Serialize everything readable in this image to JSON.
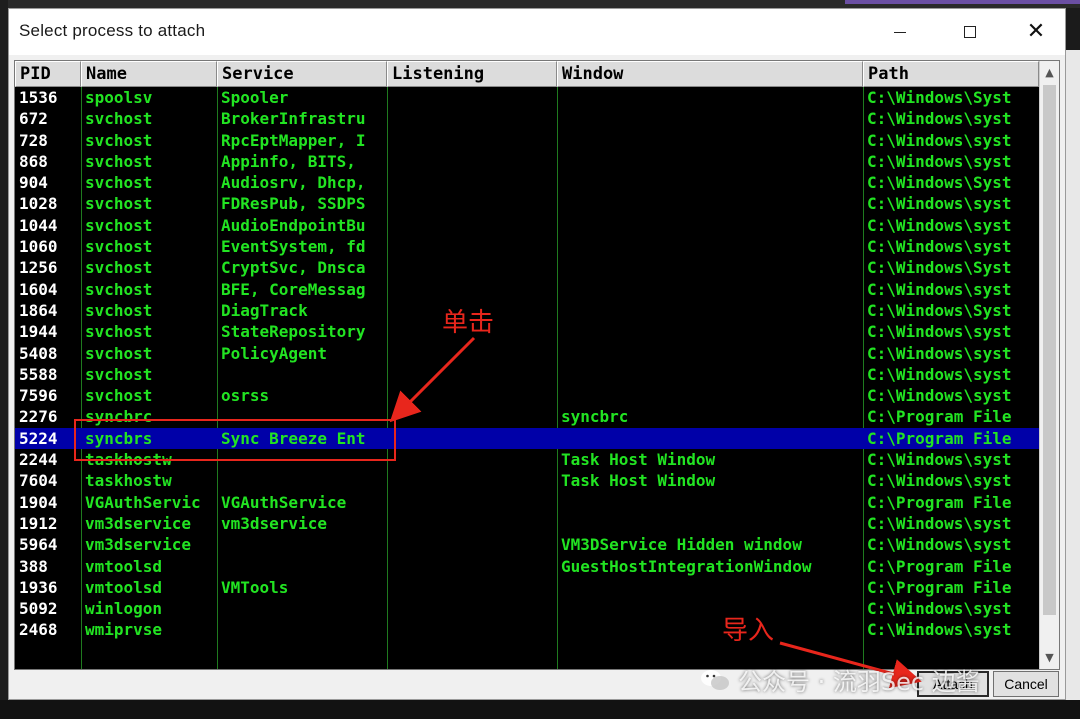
{
  "window": {
    "title": "Select process to attach",
    "close_glyph": "✕"
  },
  "table": {
    "headers": [
      "PID",
      "Name",
      "Service",
      "Listening",
      "Window",
      "Path"
    ],
    "rows": [
      {
        "pid": "1536",
        "name": "spoolsv",
        "service": "Spooler",
        "listening": "",
        "window": "",
        "path": "C:\\Windows\\Syst"
      },
      {
        "pid": "672",
        "name": "svchost",
        "service": "BrokerInfrastru",
        "listening": "",
        "window": "",
        "path": "C:\\Windows\\syst"
      },
      {
        "pid": "728",
        "name": "svchost",
        "service": "RpcEptMapper, I",
        "listening": "",
        "window": "",
        "path": "C:\\Windows\\syst"
      },
      {
        "pid": "868",
        "name": "svchost",
        "service": "Appinfo, BITS,",
        "listening": "",
        "window": "",
        "path": "C:\\Windows\\syst"
      },
      {
        "pid": "904",
        "name": "svchost",
        "service": "Audiosrv, Dhcp,",
        "listening": "",
        "window": "",
        "path": "C:\\Windows\\Syst"
      },
      {
        "pid": "1028",
        "name": "svchost",
        "service": "FDResPub, SSDPS",
        "listening": "",
        "window": "",
        "path": "C:\\Windows\\syst"
      },
      {
        "pid": "1044",
        "name": "svchost",
        "service": "AudioEndpointBu",
        "listening": "",
        "window": "",
        "path": "C:\\Windows\\syst"
      },
      {
        "pid": "1060",
        "name": "svchost",
        "service": "EventSystem, fd",
        "listening": "",
        "window": "",
        "path": "C:\\Windows\\syst"
      },
      {
        "pid": "1256",
        "name": "svchost",
        "service": "CryptSvc, Dnsca",
        "listening": "",
        "window": "",
        "path": "C:\\Windows\\Syst"
      },
      {
        "pid": "1604",
        "name": "svchost",
        "service": "BFE, CoreMessag",
        "listening": "",
        "window": "",
        "path": "C:\\Windows\\syst"
      },
      {
        "pid": "1864",
        "name": "svchost",
        "service": "DiagTrack",
        "listening": "",
        "window": "",
        "path": "C:\\Windows\\Syst"
      },
      {
        "pid": "1944",
        "name": "svchost",
        "service": "StateRepository",
        "listening": "",
        "window": "",
        "path": "C:\\Windows\\syst"
      },
      {
        "pid": "5408",
        "name": "svchost",
        "service": "PolicyAgent",
        "listening": "",
        "window": "",
        "path": "C:\\Windows\\syst"
      },
      {
        "pid": "5588",
        "name": "svchost",
        "service": "",
        "listening": "",
        "window": "",
        "path": "C:\\Windows\\syst"
      },
      {
        "pid": "7596",
        "name": "svchost",
        "service": "osrss",
        "listening": "",
        "window": "",
        "path": "C:\\Windows\\syst"
      },
      {
        "pid": "2276",
        "name": "syncbrc",
        "service": "",
        "listening": "",
        "window": "syncbrc",
        "path": "C:\\Program File"
      },
      {
        "pid": "5224",
        "name": "syncbrs",
        "service": "Sync Breeze Ent",
        "listening": "",
        "window": "",
        "path": "C:\\Program File"
      },
      {
        "pid": "2244",
        "name": "taskhostw",
        "service": "",
        "listening": "",
        "window": "Task Host Window",
        "path": "C:\\Windows\\syst"
      },
      {
        "pid": "7604",
        "name": "taskhostw",
        "service": "",
        "listening": "",
        "window": "Task Host Window",
        "path": "C:\\Windows\\syst"
      },
      {
        "pid": "1904",
        "name": "VGAuthServic",
        "service": "VGAuthService",
        "listening": "",
        "window": "",
        "path": "C:\\Program File"
      },
      {
        "pid": "1912",
        "name": "vm3dservice",
        "service": "vm3dservice",
        "listening": "",
        "window": "",
        "path": "C:\\Windows\\syst"
      },
      {
        "pid": "5964",
        "name": "vm3dservice",
        "service": "",
        "listening": "",
        "window": "VM3DService Hidden window",
        "path": "C:\\Windows\\syst"
      },
      {
        "pid": "388",
        "name": "vmtoolsd",
        "service": "",
        "listening": "",
        "window": "GuestHostIntegrationWindow",
        "path": "C:\\Program File"
      },
      {
        "pid": "1936",
        "name": "vmtoolsd",
        "service": "VMTools",
        "listening": "",
        "window": "",
        "path": "C:\\Program File"
      },
      {
        "pid": "5092",
        "name": "winlogon",
        "service": "",
        "listening": "",
        "window": "",
        "path": "C:\\Windows\\syst"
      },
      {
        "pid": "2468",
        "name": "wmiprvse",
        "service": "",
        "listening": "",
        "window": "",
        "path": "C:\\Windows\\syst"
      }
    ],
    "selected_pid": "5224"
  },
  "buttons": {
    "attach": "Attach",
    "cancel": "Cancel"
  },
  "annotations": {
    "click": "单击",
    "import": "导入",
    "color": "#e8261c"
  },
  "watermark": {
    "text": "公众号 · 流羽Sec 边酱"
  },
  "colors": {
    "row_text": "#22e422",
    "pid_text": "#ffffff",
    "selected_bg": "#0000a8",
    "table_bg": "#000000"
  }
}
